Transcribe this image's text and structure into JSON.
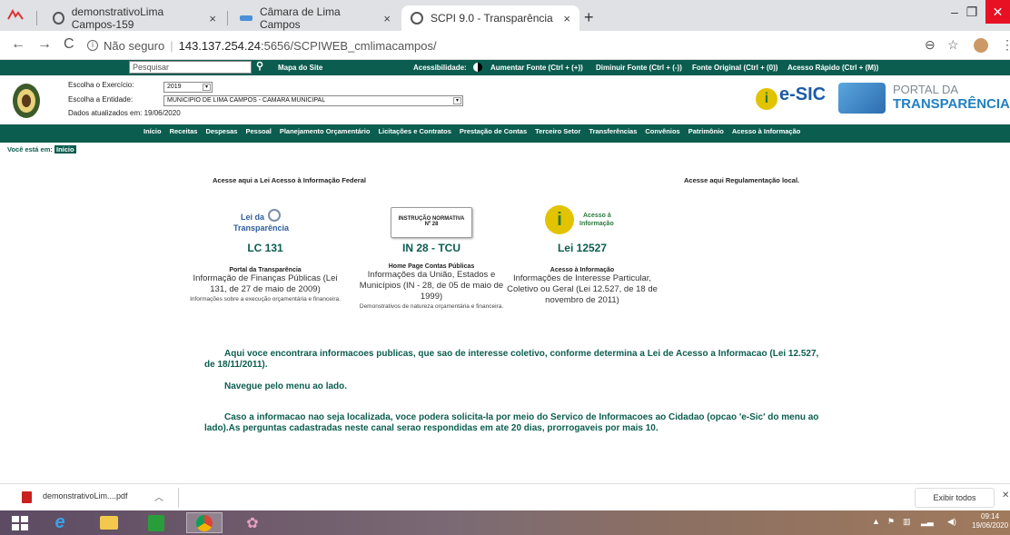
{
  "browser": {
    "tabs": [
      {
        "title": "demonstrativoLima Campos-159",
        "close": "×"
      },
      {
        "title": "Câmara de Lima Campos",
        "close": "×"
      },
      {
        "title": "SCPI 9.0 - Transparência",
        "close": "×"
      }
    ],
    "new_tab": "+",
    "address": {
      "security": "Não seguro",
      "host": "143.137.254.24",
      "path": ":5656/SCPIWEB_cmlimacampos/"
    }
  },
  "site": {
    "search_placeholder": "Pesquisar",
    "top_links": [
      "Mapa do Site",
      "Acessibilidade:",
      "Aumentar Fonte (Ctrl + (+))",
      "Diminuir Fonte (Ctrl + (-))",
      "Fonte Original (Ctrl + (0))",
      "Acesso Rápido (Ctrl + (M))"
    ],
    "exercicio_label": "Escolha o Exercício:",
    "exercicio_value": "2019",
    "entidade_label": "Escolha a Entidade:",
    "entidade_value": "MUNICIPIO DE LIMA CAMPOS - CAMARA MUNICIPAL",
    "updated": "Dados atualizados em: 19/06/2020",
    "esic_text": "e-SIC",
    "portal_line1": "PORTAL DA",
    "portal_line2": "TRANSPARÊNCIA",
    "menu": [
      "Início",
      "Receitas",
      "Despesas",
      "Pessoal",
      "Planejamento Orçamentário",
      "Licitações e Contratos",
      "Prestação de Contas",
      "Terceiro Setor",
      "Transferências",
      "Convênios",
      "Patrimônio",
      "Acesso à Informação"
    ],
    "breadcrumb_label": "Você está em:",
    "breadcrumb_home": "Início"
  },
  "content": {
    "federal_link": "Acesse aqui a Lei Acesso à Informação Federal",
    "local_link": "Acesse aqui Regulamentação local.",
    "cards": [
      {
        "img_text1": "Lei da",
        "img_text2": "Transparência",
        "big": "LC 131",
        "t1": "Portal da Transparência",
        "t2": "Informação de Finanças Públicas (Lei 131, de 27 de maio de 2009)",
        "t3": "Informações sobre a execução orçamentária e financeira."
      },
      {
        "img_text1": "INSTRUÇÃO NORMATIVA",
        "img_text2": "Nº 28",
        "big": "IN 28 - TCU",
        "t1": "Home Page Contas Públicas",
        "t2": "Informações da União, Estados e Municípios (IN - 28, de 05 de maio de 1999)",
        "t3": "Demonstrativos de natureza orçamentária e financeira."
      },
      {
        "img_text1": "Acesso à",
        "img_text2": "Informação",
        "big": "Lei 12527",
        "t1": "Acesso à Informação",
        "t2": "Informações de Interesse Particular, Coletivo ou Geral (Lei 12.527, de 18 de novembro de 2011)",
        "t3": ""
      }
    ],
    "para1": "Aqui voce encontrara informacoes publicas, que sao de interesse coletivo, conforme determina a Lei de Acesso a Informacao (Lei 12.527, de 18/11/2011).",
    "para2": "Navegue pelo menu ao lado.",
    "para3": "Caso a informacao nao seja localizada, voce podera solicita-la por meio do Servico de Informacoes ao Cidadao (opcao 'e-Sic' do menu ao lado).As perguntas cadastradas neste canal serao respondidas em ate 20 dias, prorrogaveis por mais 10."
  },
  "downloads": {
    "file": "demonstrativoLim....pdf",
    "show_all": "Exibir todos"
  },
  "taskbar": {
    "time": "09:14",
    "date": "19/06/2020"
  },
  "colors": {
    "brand_green": "#0b5d4f"
  }
}
